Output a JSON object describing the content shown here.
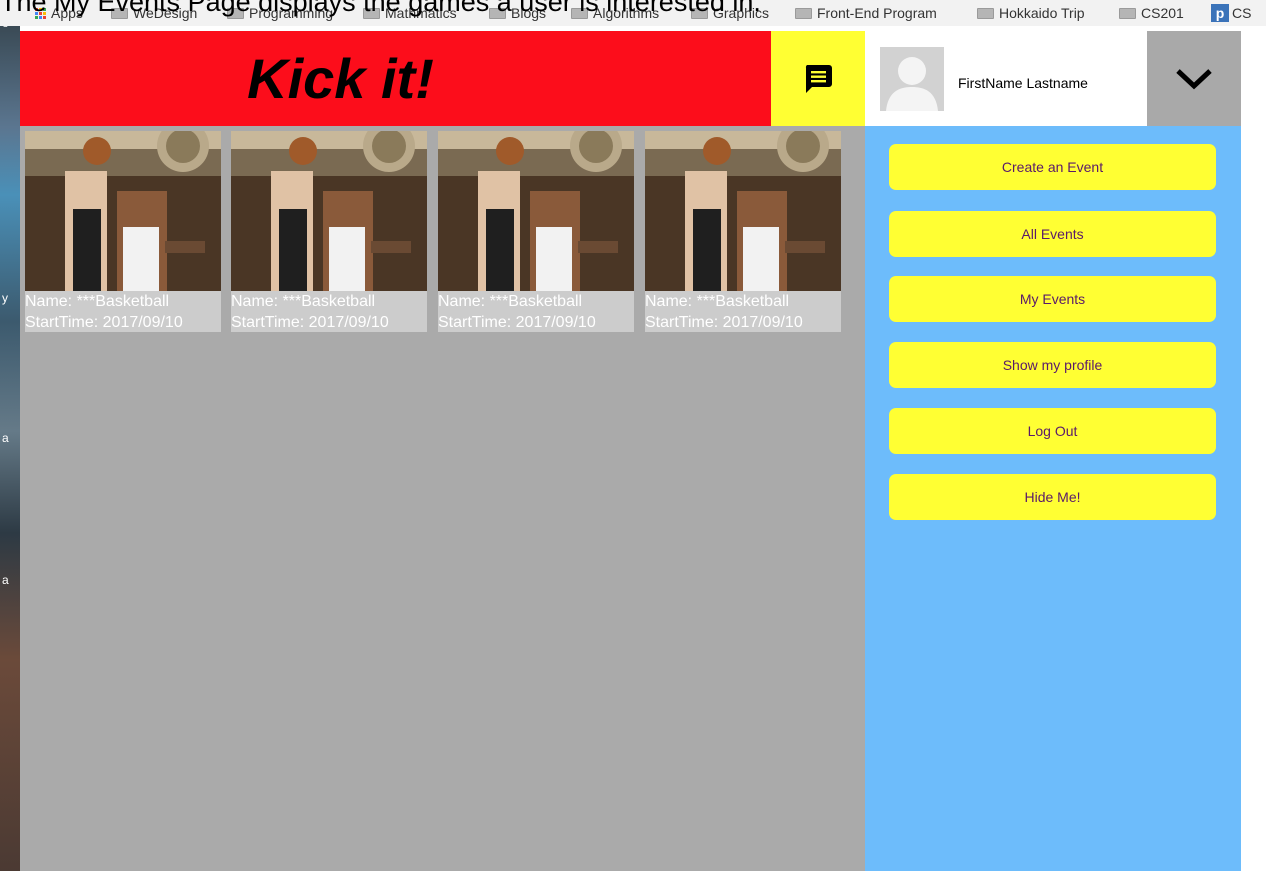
{
  "caption": "The My Events Page displays the games a user is interested in.",
  "bookmarks": [
    {
      "label": "Apps",
      "icon": "apps-grid-icon"
    },
    {
      "label": "WeDesign",
      "icon": "folder-icon"
    },
    {
      "label": "Programming",
      "icon": "folder-icon"
    },
    {
      "label": "Mathmatics",
      "icon": "folder-icon"
    },
    {
      "label": "Blogs",
      "icon": "folder-icon"
    },
    {
      "label": "Algorithms",
      "icon": "folder-icon"
    },
    {
      "label": "Graphics",
      "icon": "folder-icon"
    },
    {
      "label": "Front-End Program",
      "icon": "folder-icon"
    },
    {
      "label": "Hokkaido Trip",
      "icon": "folder-icon"
    },
    {
      "label": "CS201",
      "icon": "folder-icon"
    },
    {
      "label": "CS",
      "icon": "p-icon"
    }
  ],
  "left_strip": {
    "t1": "o",
    "t2": "y",
    "t3": "a",
    "t4": "a"
  },
  "header": {
    "brand": "Kick it!",
    "chat_icon": "chat-bubble-icon",
    "user_name": "FirstName Lastname",
    "dropdown_icon": "chevron-down-icon"
  },
  "events": [
    {
      "name": "Name: ***Basketball",
      "start": "StartTime: 2017/09/10"
    },
    {
      "name": "Name: ***Basketball",
      "start": "StartTime: 2017/09/10"
    },
    {
      "name": "Name: ***Basketball",
      "start": "StartTime: 2017/09/10"
    },
    {
      "name": "Name: ***Basketball",
      "start": "StartTime: 2017/09/10"
    }
  ],
  "menu": {
    "create": "Create an Event",
    "all": "All Events",
    "mine": "My Events",
    "profile": "Show my profile",
    "logout": "Log Out",
    "hide": "Hide Me!"
  },
  "colors": {
    "header_red": "#fc0d1b",
    "accent_yellow": "#ffff33",
    "sidebar_blue": "#6dbcfb",
    "content_gray": "#aaaaaa"
  }
}
